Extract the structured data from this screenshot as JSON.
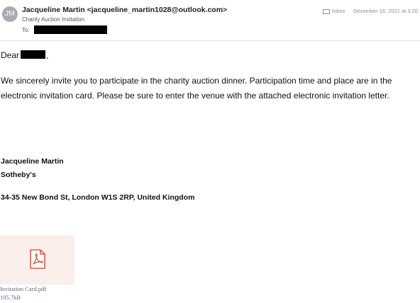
{
  "header": {
    "avatar_initials": "JM",
    "sender": "Jacqueline Martin <jacqueline_martin1028@outlook.com>",
    "subject": "Charity Auction Invitation",
    "to_label": "To:",
    "folder": "Inbox",
    "folder_icon": "inbox-icon",
    "date": "December 16, 2021 at 3:20"
  },
  "message": {
    "greeting_prefix": "Dear",
    "greeting_suffix": ",",
    "body": "We sincerely invite you to participate in the charity auction dinner. Participation time and place are in the electronic invitation card. Please be sure to enter the venue with the attached electronic invitation letter.",
    "signature_name": "Jacqueline Martin",
    "signature_org": "Sotheby's",
    "signature_address": "34-35 New Bond St, London W1S 2RP, United Kingdom"
  },
  "attachment": {
    "icon": "pdf-file-icon",
    "name": "Invitation Card.pdf",
    "size": "105.7kB"
  },
  "colors": {
    "avatar_bg": "#a9adb3",
    "pdf_red": "#e25a47",
    "thumb_bg": "#fbefec",
    "meta_gray": "#8c8c8c"
  }
}
